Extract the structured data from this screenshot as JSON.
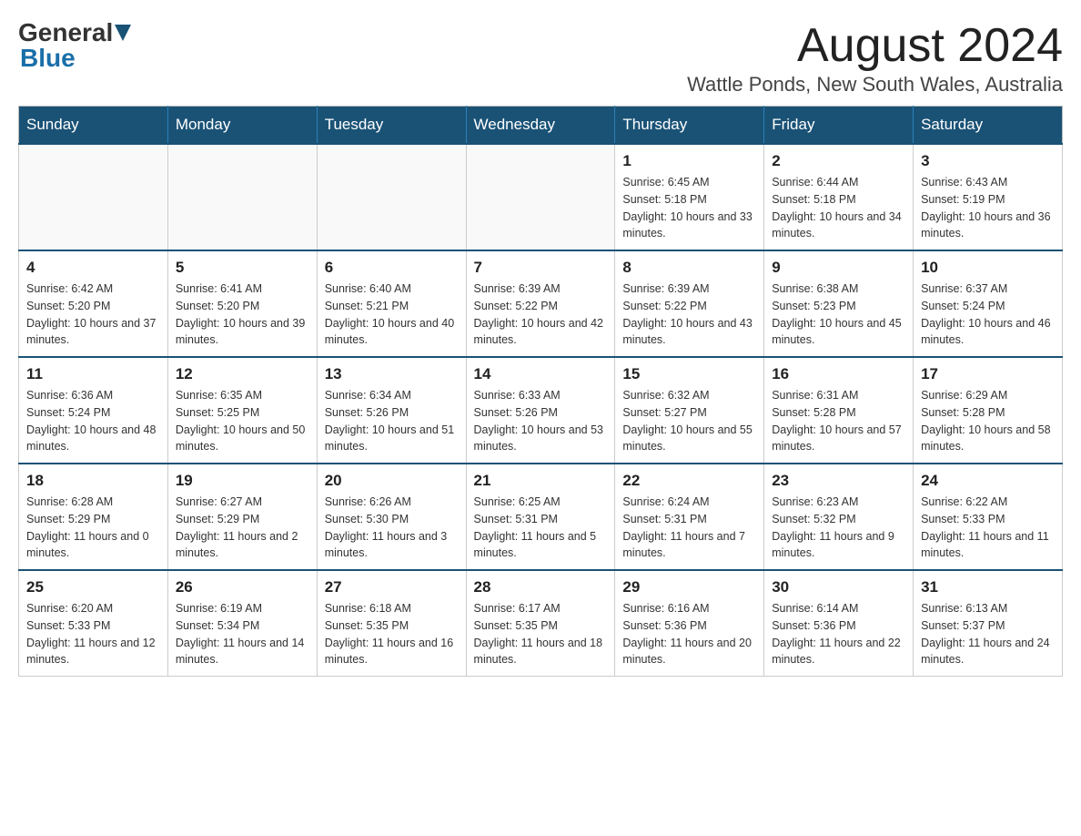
{
  "logo": {
    "general": "General",
    "blue": "Blue"
  },
  "title": "August 2024",
  "location": "Wattle Ponds, New South Wales, Australia",
  "days_of_week": [
    "Sunday",
    "Monday",
    "Tuesday",
    "Wednesday",
    "Thursday",
    "Friday",
    "Saturday"
  ],
  "weeks": [
    [
      {
        "day": "",
        "info": ""
      },
      {
        "day": "",
        "info": ""
      },
      {
        "day": "",
        "info": ""
      },
      {
        "day": "",
        "info": ""
      },
      {
        "day": "1",
        "info": "Sunrise: 6:45 AM\nSunset: 5:18 PM\nDaylight: 10 hours and 33 minutes."
      },
      {
        "day": "2",
        "info": "Sunrise: 6:44 AM\nSunset: 5:18 PM\nDaylight: 10 hours and 34 minutes."
      },
      {
        "day": "3",
        "info": "Sunrise: 6:43 AM\nSunset: 5:19 PM\nDaylight: 10 hours and 36 minutes."
      }
    ],
    [
      {
        "day": "4",
        "info": "Sunrise: 6:42 AM\nSunset: 5:20 PM\nDaylight: 10 hours and 37 minutes."
      },
      {
        "day": "5",
        "info": "Sunrise: 6:41 AM\nSunset: 5:20 PM\nDaylight: 10 hours and 39 minutes."
      },
      {
        "day": "6",
        "info": "Sunrise: 6:40 AM\nSunset: 5:21 PM\nDaylight: 10 hours and 40 minutes."
      },
      {
        "day": "7",
        "info": "Sunrise: 6:39 AM\nSunset: 5:22 PM\nDaylight: 10 hours and 42 minutes."
      },
      {
        "day": "8",
        "info": "Sunrise: 6:39 AM\nSunset: 5:22 PM\nDaylight: 10 hours and 43 minutes."
      },
      {
        "day": "9",
        "info": "Sunrise: 6:38 AM\nSunset: 5:23 PM\nDaylight: 10 hours and 45 minutes."
      },
      {
        "day": "10",
        "info": "Sunrise: 6:37 AM\nSunset: 5:24 PM\nDaylight: 10 hours and 46 minutes."
      }
    ],
    [
      {
        "day": "11",
        "info": "Sunrise: 6:36 AM\nSunset: 5:24 PM\nDaylight: 10 hours and 48 minutes."
      },
      {
        "day": "12",
        "info": "Sunrise: 6:35 AM\nSunset: 5:25 PM\nDaylight: 10 hours and 50 minutes."
      },
      {
        "day": "13",
        "info": "Sunrise: 6:34 AM\nSunset: 5:26 PM\nDaylight: 10 hours and 51 minutes."
      },
      {
        "day": "14",
        "info": "Sunrise: 6:33 AM\nSunset: 5:26 PM\nDaylight: 10 hours and 53 minutes."
      },
      {
        "day": "15",
        "info": "Sunrise: 6:32 AM\nSunset: 5:27 PM\nDaylight: 10 hours and 55 minutes."
      },
      {
        "day": "16",
        "info": "Sunrise: 6:31 AM\nSunset: 5:28 PM\nDaylight: 10 hours and 57 minutes."
      },
      {
        "day": "17",
        "info": "Sunrise: 6:29 AM\nSunset: 5:28 PM\nDaylight: 10 hours and 58 minutes."
      }
    ],
    [
      {
        "day": "18",
        "info": "Sunrise: 6:28 AM\nSunset: 5:29 PM\nDaylight: 11 hours and 0 minutes."
      },
      {
        "day": "19",
        "info": "Sunrise: 6:27 AM\nSunset: 5:29 PM\nDaylight: 11 hours and 2 minutes."
      },
      {
        "day": "20",
        "info": "Sunrise: 6:26 AM\nSunset: 5:30 PM\nDaylight: 11 hours and 3 minutes."
      },
      {
        "day": "21",
        "info": "Sunrise: 6:25 AM\nSunset: 5:31 PM\nDaylight: 11 hours and 5 minutes."
      },
      {
        "day": "22",
        "info": "Sunrise: 6:24 AM\nSunset: 5:31 PM\nDaylight: 11 hours and 7 minutes."
      },
      {
        "day": "23",
        "info": "Sunrise: 6:23 AM\nSunset: 5:32 PM\nDaylight: 11 hours and 9 minutes."
      },
      {
        "day": "24",
        "info": "Sunrise: 6:22 AM\nSunset: 5:33 PM\nDaylight: 11 hours and 11 minutes."
      }
    ],
    [
      {
        "day": "25",
        "info": "Sunrise: 6:20 AM\nSunset: 5:33 PM\nDaylight: 11 hours and 12 minutes."
      },
      {
        "day": "26",
        "info": "Sunrise: 6:19 AM\nSunset: 5:34 PM\nDaylight: 11 hours and 14 minutes."
      },
      {
        "day": "27",
        "info": "Sunrise: 6:18 AM\nSunset: 5:35 PM\nDaylight: 11 hours and 16 minutes."
      },
      {
        "day": "28",
        "info": "Sunrise: 6:17 AM\nSunset: 5:35 PM\nDaylight: 11 hours and 18 minutes."
      },
      {
        "day": "29",
        "info": "Sunrise: 6:16 AM\nSunset: 5:36 PM\nDaylight: 11 hours and 20 minutes."
      },
      {
        "day": "30",
        "info": "Sunrise: 6:14 AM\nSunset: 5:36 PM\nDaylight: 11 hours and 22 minutes."
      },
      {
        "day": "31",
        "info": "Sunrise: 6:13 AM\nSunset: 5:37 PM\nDaylight: 11 hours and 24 minutes."
      }
    ]
  ]
}
